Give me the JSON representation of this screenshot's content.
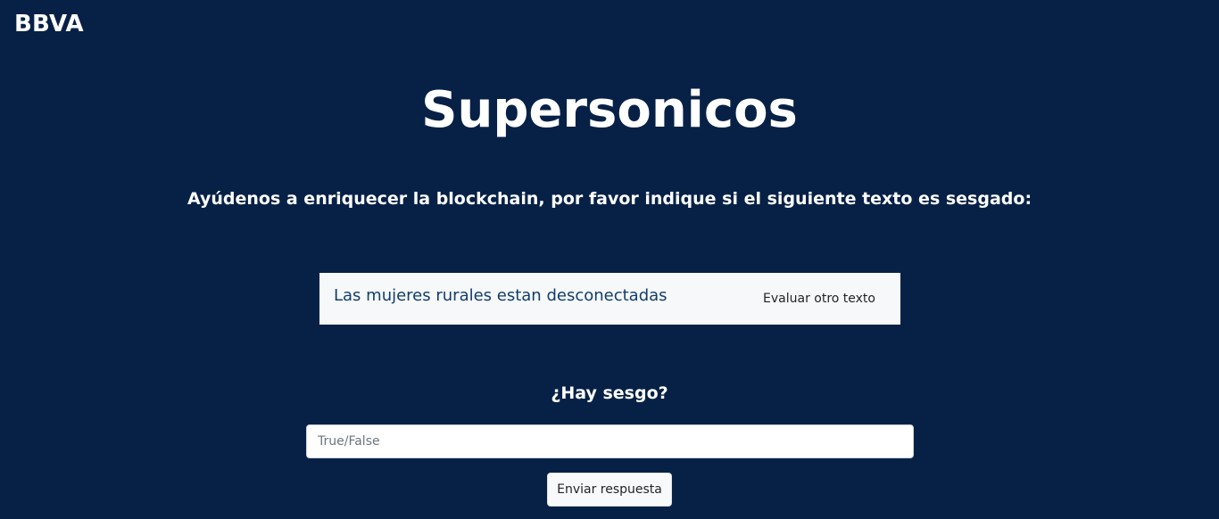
{
  "navbar": {
    "brand": "BBVA"
  },
  "main": {
    "title": "Supersonicos",
    "prompt": "Ayúdenos a enriquecer la blockchain, por favor indique si el siguiente texto es sesgado:",
    "sample_text": "Las mujeres rurales estan desconectadas",
    "other_text_button": "Evaluar otro texto",
    "question": "¿Hay sesgo?",
    "answer_input": {
      "value": "",
      "placeholder": "True/False"
    },
    "submit_button": "Enviar respuesta"
  },
  "colors": {
    "background": "#072146",
    "card_background": "#f6f8fa",
    "sample_text": "#123d6a",
    "heading_text": "#ffffff"
  }
}
